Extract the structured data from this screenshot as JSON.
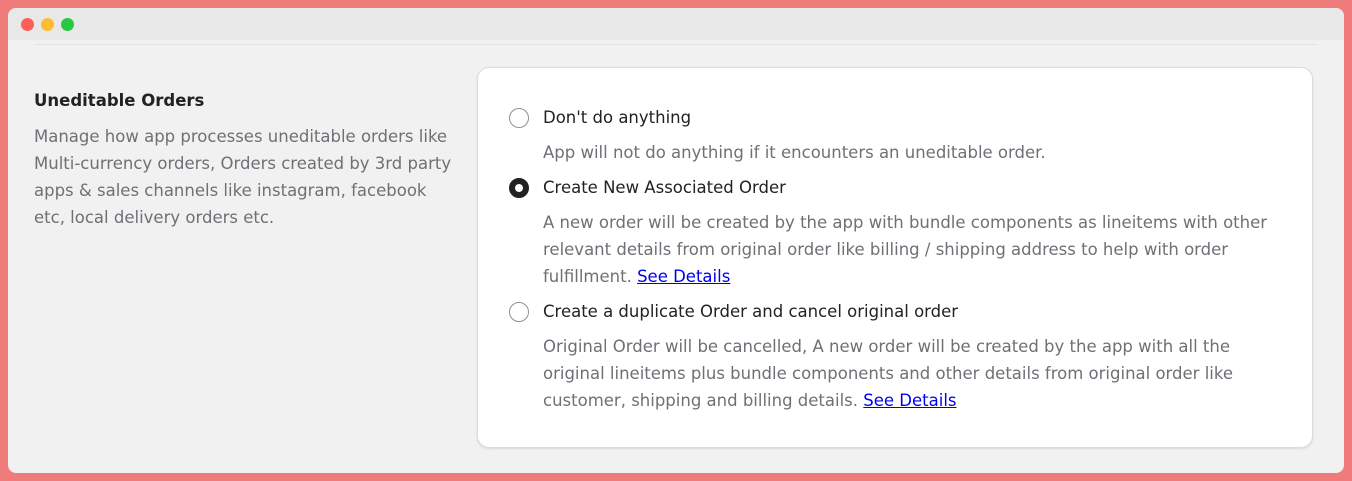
{
  "section": {
    "title": "Uneditable Orders",
    "description": "Manage how app processes uneditable orders like Multi-currency orders, Orders created by 3rd party apps & sales channels like instagram, facebook etc, local delivery orders etc."
  },
  "options": [
    {
      "label": "Don't do anything",
      "help": "App will not do anything if it encounters an uneditable order.",
      "link": "",
      "selected": false
    },
    {
      "label": "Create New Associated Order",
      "help": "A new order will be created by the app with bundle components as lineitems with other relevant details from original order like billing / shipping address to help with order fulfillment.",
      "link": "See Details",
      "selected": true
    },
    {
      "label": "Create a duplicate Order and cancel original order",
      "help": "Original Order will be cancelled, A new order will be created by the app with all the original lineitems plus bundle components and other details from original order like customer, shipping and billing details.",
      "link": "See Details",
      "selected": false
    }
  ],
  "colors": {
    "frame": "#f07b7b",
    "link": "#0000ee"
  }
}
